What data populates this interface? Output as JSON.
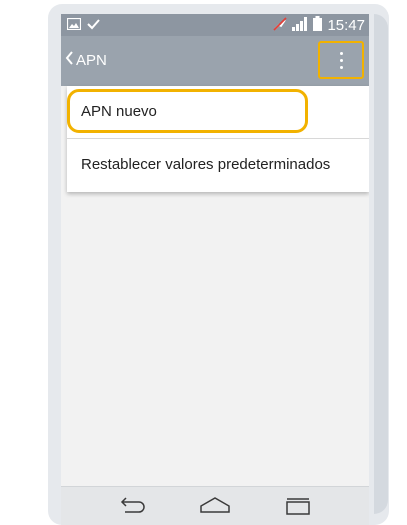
{
  "status_bar": {
    "time": "15:47",
    "icons": [
      "image-icon",
      "check-icon",
      "mute-icon",
      "signal-icon",
      "battery-icon"
    ]
  },
  "app_bar": {
    "title": "APN",
    "back_icon": "chevron-left-icon",
    "overflow_icon": "more-vertical-icon"
  },
  "menu": {
    "items": [
      {
        "label": "APN nuevo"
      },
      {
        "label": "Restablecer valores predeterminados"
      }
    ]
  },
  "nav_bar": {
    "icons": [
      "back-icon",
      "home-icon",
      "recent-apps-icon"
    ]
  },
  "colors": {
    "highlight": "#f2b200",
    "status_bar": "#8d96a1",
    "app_bar": "#9aa3ad"
  }
}
